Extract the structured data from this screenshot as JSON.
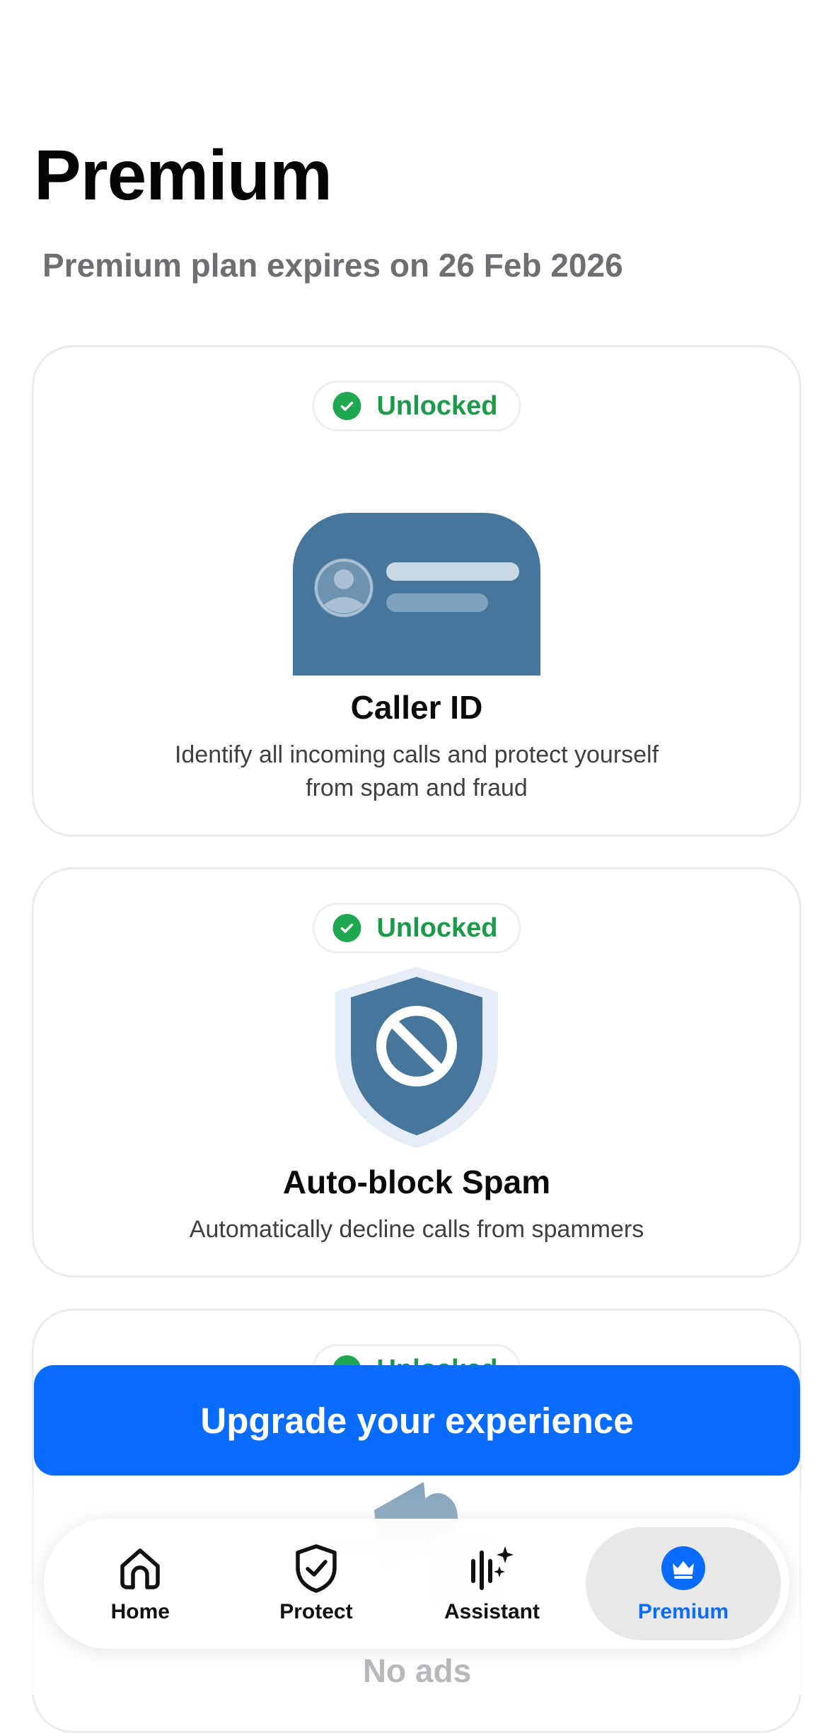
{
  "header": {
    "title": "Premium",
    "subtitle": "Premium plan expires on 26 Feb 2026"
  },
  "features": [
    {
      "badge": "Unlocked",
      "title": "Caller ID",
      "description_line1": "Identify all incoming calls and protect yourself",
      "description_line2": "from spam and fraud",
      "icon": "caller-id-card-icon"
    },
    {
      "badge": "Unlocked",
      "title": "Auto-block Spam",
      "description_line1": "Automatically decline calls from spammers",
      "icon": "shield-block-icon"
    },
    {
      "badge": "Unlocked",
      "title": "No ads",
      "icon": "megaphone-icon"
    }
  ],
  "cta": {
    "label": "Upgrade your experience"
  },
  "nav": {
    "items": [
      {
        "label": "Home",
        "icon": "home-icon",
        "active": false
      },
      {
        "label": "Protect",
        "icon": "shield-check-icon",
        "active": false
      },
      {
        "label": "Assistant",
        "icon": "assistant-sparkle-icon",
        "active": false
      },
      {
        "label": "Premium",
        "icon": "crown-icon",
        "active": true
      }
    ]
  },
  "colors": {
    "accent": "#0a6cff",
    "unlocked_green": "#1c9a4a",
    "illustration_blue": "#46769b"
  }
}
